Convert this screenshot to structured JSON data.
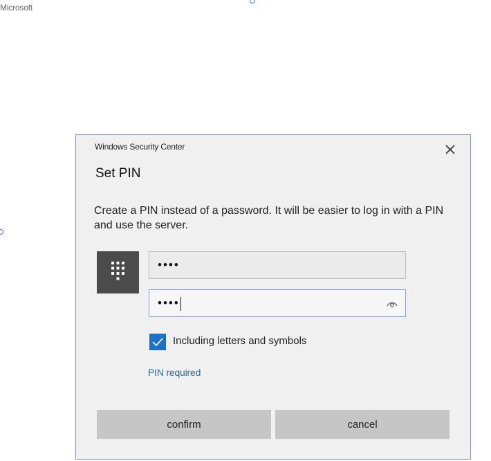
{
  "page": {
    "brand": "Microsoft"
  },
  "dialog": {
    "caption": "Windows Security Center",
    "title": "Set PIN",
    "description": "Create a PIN instead of a password. It will be easier to log in with a PIN and use the server.",
    "pin_field": {
      "value": "••••"
    },
    "confirm_field": {
      "value": "••••"
    },
    "checkbox": {
      "label": "Including letters and symbols",
      "checked": true
    },
    "requirement_text": "PIN required",
    "buttons": {
      "confirm_label": "confirm",
      "cancel_label": "cancel"
    },
    "icons": {
      "close": "close-icon",
      "keypad": "keypad-icon",
      "reveal": "eye-icon",
      "check": "checkmark-icon"
    },
    "colors": {
      "dialog_bg": "#f0f0f0",
      "dialog_border": "#7c9ac4",
      "checkbox_bg": "#1a73c9",
      "link": "#2f6aa3",
      "button_bg": "#c6c6c6",
      "tile_bg": "#4b4b4b"
    }
  }
}
